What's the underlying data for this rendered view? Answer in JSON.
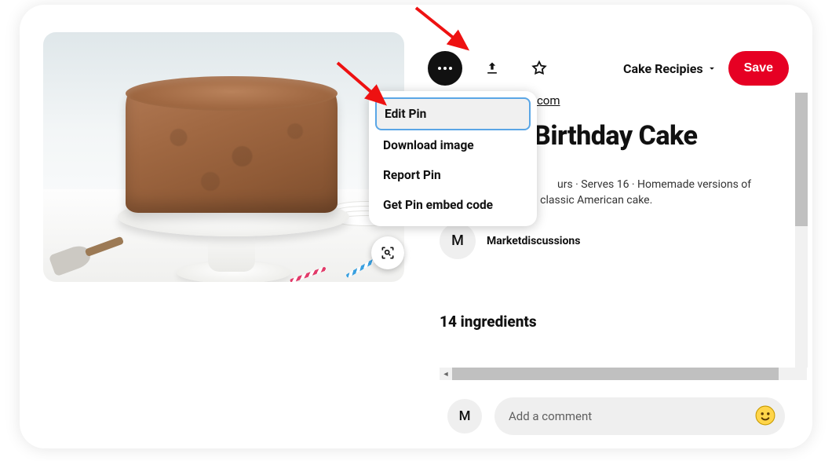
{
  "toolbar": {
    "board_name": "Cake Recipies",
    "save_label": "Save"
  },
  "menu": {
    "items": [
      "Edit Pin",
      "Download image",
      "Report Pin",
      "Get Pin embed code"
    ],
    "selected_index": 0
  },
  "pin": {
    "source_domain_partial": ".com",
    "title": "Birthday Cake",
    "meta_partial_line1": "urs · Serves 16 · Homemade versions of",
    "meta_line2": "chocolate-on-vanilla classic American cake.",
    "author_initial": "M",
    "author_name": "Marketdiscussions",
    "ingredients_heading": "14 ingredients"
  },
  "comment": {
    "avatar_initial": "M",
    "placeholder": "Add a comment"
  }
}
